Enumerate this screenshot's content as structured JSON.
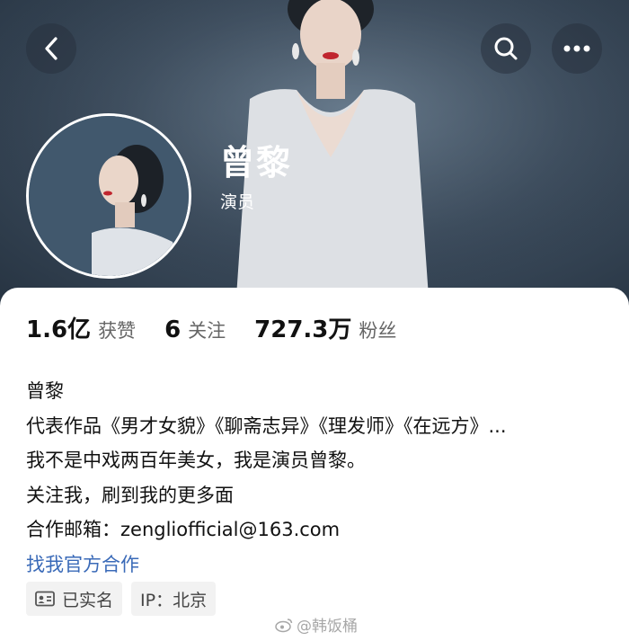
{
  "profile": {
    "name": "曾黎",
    "role": "演员"
  },
  "stats": [
    {
      "value": "1.6亿",
      "label": "获赞"
    },
    {
      "value": "6",
      "label": "关注"
    },
    {
      "value": "727.3万",
      "label": "粉丝"
    }
  ],
  "bio": {
    "line1": "曾黎",
    "line2": "代表作品《男才女貌》《聊斋志异》《理发师》《在远方》...",
    "line3": "我不是中戏两百年美女，我是演员曾黎。",
    "line4": "关注我，刷到我的更多面",
    "line5": "合作邮箱：zengliofficial@163.com",
    "link": "找我官方合作"
  },
  "tags": {
    "verified": "已实名",
    "ip": "IP：北京"
  },
  "watermark": "@韩饭桶",
  "icons": {
    "back": "chevron-left-icon",
    "search": "search-icon",
    "more": "more-icon",
    "id_card": "id-card-icon",
    "weibo": "weibo-icon"
  },
  "colors": {
    "link": "#3a6ab8",
    "header_bg": "#3d4d5e"
  }
}
